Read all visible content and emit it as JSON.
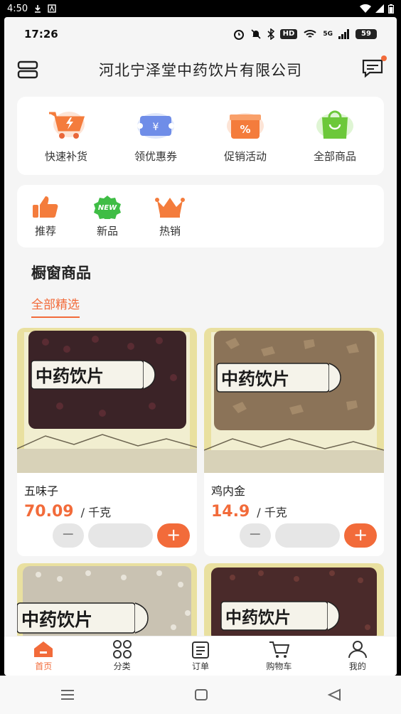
{
  "system_status": {
    "time": "4:50",
    "download_icon": "download-icon",
    "a_icon": "a-badge-icon"
  },
  "inner_status": {
    "time": "17:26",
    "hd": "HD",
    "network": "5G",
    "battery": "59"
  },
  "header": {
    "title": "河北宁泽堂中药饮片有限公司"
  },
  "quick_actions": [
    {
      "label": "快速补货",
      "icon": "cart-bolt-icon"
    },
    {
      "label": "领优惠券",
      "icon": "coupon-icon"
    },
    {
      "label": "促销活动",
      "icon": "gift-percent-icon"
    },
    {
      "label": "全部商品",
      "icon": "bag-icon"
    }
  ],
  "tags": [
    {
      "label": "推荐",
      "icon": "thumbs-up-icon"
    },
    {
      "label": "新品",
      "icon": "new-badge-icon",
      "badge": "NEW"
    },
    {
      "label": "热销",
      "icon": "crown-icon"
    }
  ],
  "section": {
    "title": "橱窗商品",
    "active_tab": "全部精选"
  },
  "products": [
    {
      "name": "五味子",
      "price": "70.09",
      "unit": "/ 千克",
      "package_text": "中药饮片"
    },
    {
      "name": "鸡内金",
      "price": "14.9",
      "unit": "/ 千克",
      "package_text": "中药饮片"
    },
    {
      "package_text": "中药饮片"
    },
    {
      "package_text": "中药饮片"
    }
  ],
  "tabbar": [
    {
      "label": "首页",
      "icon": "home-icon",
      "active": true
    },
    {
      "label": "分类",
      "icon": "category-icon"
    },
    {
      "label": "订单",
      "icon": "order-icon"
    },
    {
      "label": "购物车",
      "icon": "cart-icon"
    },
    {
      "label": "我的",
      "icon": "user-icon"
    }
  ],
  "controls": {
    "minus": "−",
    "plus": "+"
  },
  "colors": {
    "accent": "#f26b3a",
    "background": "#f5f5f5"
  }
}
